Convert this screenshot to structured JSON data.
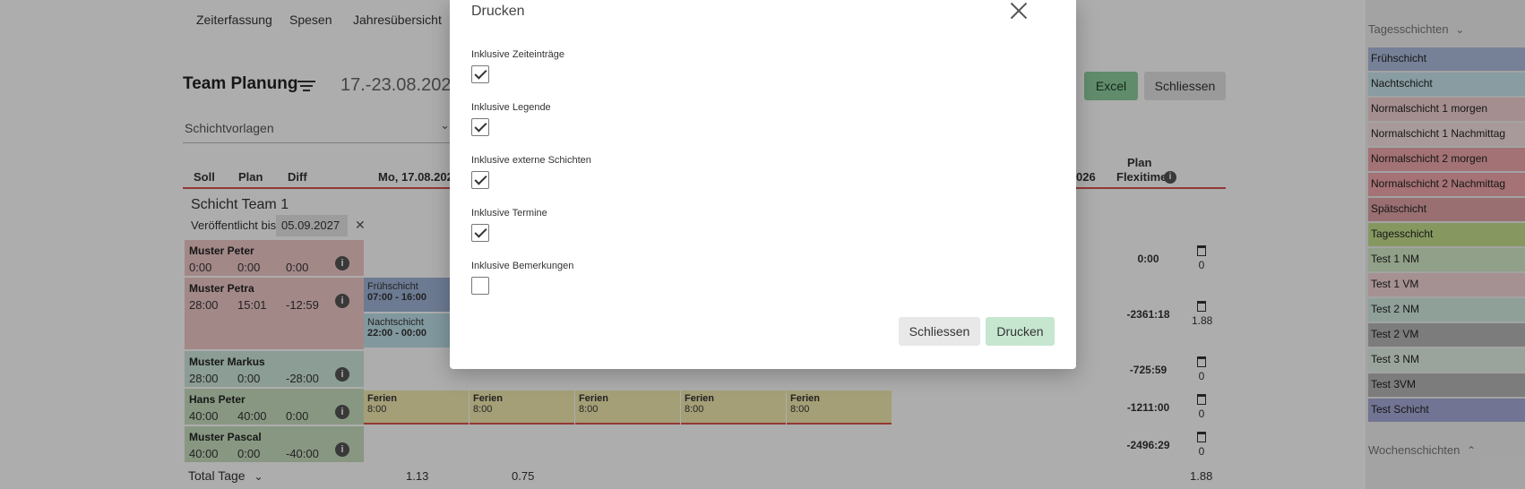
{
  "nav": [
    "Zeiterfassung",
    "Spesen",
    "Jahresübersicht"
  ],
  "header": {
    "title": "Team Planung",
    "date_range": "17.-23.08.2026",
    "excel_label": "Excel",
    "close_label": "Schliessen"
  },
  "template_select": {
    "value": "Schichtvorlagen"
  },
  "table_headers": {
    "soll": "Soll",
    "plan": "Plan",
    "diff": "Diff",
    "day1": "Mo, 17.08.2026",
    "last_day_suffix": "026",
    "plan_flexitime_1": "Plan",
    "plan_flexitime_2": "Flexitime"
  },
  "team": {
    "name": "Schicht Team 1",
    "published_label": "Veröffentlicht bis",
    "published_date": "05.09.2027"
  },
  "employees": [
    {
      "name": "Muster Peter",
      "soll": "0:00",
      "plan": "0:00",
      "diff": "0:00",
      "flexitime": "0:00",
      "trash_count": "0",
      "color": "#f1c9c9"
    },
    {
      "name": "Muster Petra",
      "soll": "28:00",
      "plan": "15:01",
      "diff": "-12:59",
      "flexitime": "-2361:18",
      "trash_count": "1.88",
      "color": "#f1c9c9"
    },
    {
      "name": "Muster Markus",
      "soll": "28:00",
      "plan": "0:00",
      "diff": "-28:00",
      "flexitime": "-725:59",
      "trash_count": "0",
      "color": "#cde7dc"
    },
    {
      "name": "Hans Peter",
      "soll": "40:00",
      "plan": "40:00",
      "diff": "0:00",
      "flexitime": "-1211:00",
      "trash_count": "0",
      "color": "#c9dfc0"
    },
    {
      "name": "Muster Pascal",
      "soll": "40:00",
      "plan": "0:00",
      "diff": "-40:00",
      "flexitime": "-2496:29",
      "trash_count": "0",
      "color": "#c9dfc0"
    }
  ],
  "petra_shifts": [
    {
      "name": "Frühschicht",
      "time": "07:00 - 16:00",
      "color": "#9fb4d8"
    },
    {
      "name": "Nachtschicht",
      "time": "22:00 - 00:00",
      "color": "#bfe0ea"
    }
  ],
  "ferien": {
    "label": "Ferien",
    "time": "8:00"
  },
  "total": {
    "label": "Total Tage",
    "v1": "1.13",
    "v2": "0.75",
    "sum": "1.88"
  },
  "right_panel": {
    "day_shifts_label": "Tagesschichten",
    "week_shifts_label": "Wochenschichten",
    "shifts": [
      {
        "name": "Frühschicht",
        "color": "#aebfdf"
      },
      {
        "name": "Nachtschicht",
        "color": "#c9e6ee"
      },
      {
        "name": "Normalschicht 1 morgen",
        "color": "#f3d1d3"
      },
      {
        "name": "Normalschicht 1 Nachmittag",
        "color": "#f8e3e4"
      },
      {
        "name": "Normalschicht 2 morgen",
        "color": "#f0a9ad"
      },
      {
        "name": "Normalschicht 2 Nachmittag",
        "color": "#f3a8ad"
      },
      {
        "name": "Spätschicht",
        "color": "#e2a4a7"
      },
      {
        "name": "Tagesschicht",
        "color": "#c6e08e"
      },
      {
        "name": "Test 1 NM",
        "color": "#d6ecc9"
      },
      {
        "name": "Test 1 VM",
        "color": "#f5d6d8"
      },
      {
        "name": "Test 2 NM",
        "color": "#d3ece2"
      },
      {
        "name": "Test 2 VM",
        "color": "#b7b7b7"
      },
      {
        "name": "Test 3 NM",
        "color": "#e3f1e6"
      },
      {
        "name": "Test 3VM",
        "color": "#b7b7b7"
      },
      {
        "name": "Test Schicht",
        "color": "#a8acd9"
      }
    ]
  },
  "modal": {
    "title": "Drucken",
    "options": [
      {
        "label": "Inklusive Zeiteinträge",
        "checked": true
      },
      {
        "label": "Inklusive Legende",
        "checked": true
      },
      {
        "label": "Inklusive externe Schichten",
        "checked": true
      },
      {
        "label": "Inklusive Termine",
        "checked": true
      },
      {
        "label": "Inklusive Bemerkungen",
        "checked": false
      }
    ],
    "close_label": "Schliessen",
    "print_label": "Drucken"
  }
}
